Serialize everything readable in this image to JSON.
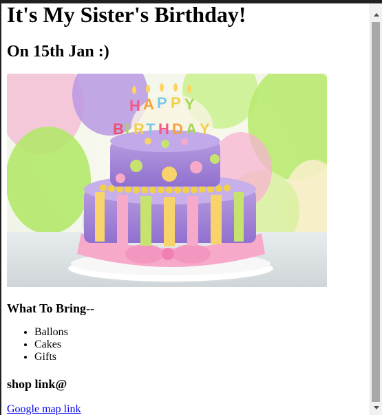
{
  "page": {
    "title": "It's My Sister's Birthday!",
    "subtitle": "On 15th Jan :)"
  },
  "image": {
    "alt": "birthday cake",
    "banner_text": "HAPPY BIRTHDAY"
  },
  "bring": {
    "heading": "What To Bring",
    "suffix": "--",
    "items": [
      "Ballons",
      "Cakes",
      "Gifts"
    ]
  },
  "shop": {
    "heading": "shop link@",
    "link_text": "Google map link"
  },
  "colors": {
    "link": "#0000ee",
    "border": "#202020",
    "scroll_thumb": "#a8a8a8"
  }
}
